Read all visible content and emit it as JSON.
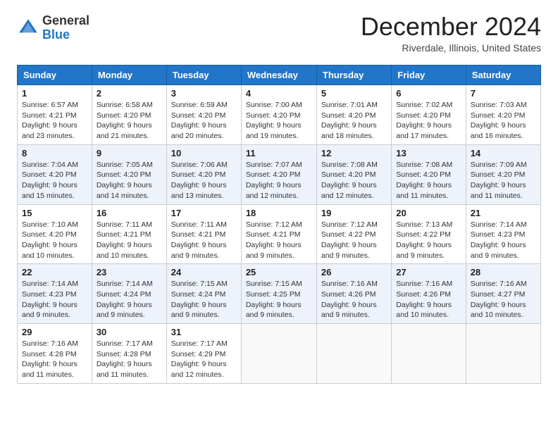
{
  "header": {
    "logo_general": "General",
    "logo_blue": "Blue",
    "month_title": "December 2024",
    "location": "Riverdale, Illinois, United States"
  },
  "days_of_week": [
    "Sunday",
    "Monday",
    "Tuesday",
    "Wednesday",
    "Thursday",
    "Friday",
    "Saturday"
  ],
  "weeks": [
    [
      {
        "day": "1",
        "sunrise": "6:57 AM",
        "sunset": "4:21 PM",
        "daylight": "9 hours and 23 minutes."
      },
      {
        "day": "2",
        "sunrise": "6:58 AM",
        "sunset": "4:20 PM",
        "daylight": "9 hours and 21 minutes."
      },
      {
        "day": "3",
        "sunrise": "6:59 AM",
        "sunset": "4:20 PM",
        "daylight": "9 hours and 20 minutes."
      },
      {
        "day": "4",
        "sunrise": "7:00 AM",
        "sunset": "4:20 PM",
        "daylight": "9 hours and 19 minutes."
      },
      {
        "day": "5",
        "sunrise": "7:01 AM",
        "sunset": "4:20 PM",
        "daylight": "9 hours and 18 minutes."
      },
      {
        "day": "6",
        "sunrise": "7:02 AM",
        "sunset": "4:20 PM",
        "daylight": "9 hours and 17 minutes."
      },
      {
        "day": "7",
        "sunrise": "7:03 AM",
        "sunset": "4:20 PM",
        "daylight": "9 hours and 16 minutes."
      }
    ],
    [
      {
        "day": "8",
        "sunrise": "7:04 AM",
        "sunset": "4:20 PM",
        "daylight": "9 hours and 15 minutes."
      },
      {
        "day": "9",
        "sunrise": "7:05 AM",
        "sunset": "4:20 PM",
        "daylight": "9 hours and 14 minutes."
      },
      {
        "day": "10",
        "sunrise": "7:06 AM",
        "sunset": "4:20 PM",
        "daylight": "9 hours and 13 minutes."
      },
      {
        "day": "11",
        "sunrise": "7:07 AM",
        "sunset": "4:20 PM",
        "daylight": "9 hours and 12 minutes."
      },
      {
        "day": "12",
        "sunrise": "7:08 AM",
        "sunset": "4:20 PM",
        "daylight": "9 hours and 12 minutes."
      },
      {
        "day": "13",
        "sunrise": "7:08 AM",
        "sunset": "4:20 PM",
        "daylight": "9 hours and 11 minutes."
      },
      {
        "day": "14",
        "sunrise": "7:09 AM",
        "sunset": "4:20 PM",
        "daylight": "9 hours and 11 minutes."
      }
    ],
    [
      {
        "day": "15",
        "sunrise": "7:10 AM",
        "sunset": "4:20 PM",
        "daylight": "9 hours and 10 minutes."
      },
      {
        "day": "16",
        "sunrise": "7:11 AM",
        "sunset": "4:21 PM",
        "daylight": "9 hours and 10 minutes."
      },
      {
        "day": "17",
        "sunrise": "7:11 AM",
        "sunset": "4:21 PM",
        "daylight": "9 hours and 9 minutes."
      },
      {
        "day": "18",
        "sunrise": "7:12 AM",
        "sunset": "4:21 PM",
        "daylight": "9 hours and 9 minutes."
      },
      {
        "day": "19",
        "sunrise": "7:12 AM",
        "sunset": "4:22 PM",
        "daylight": "9 hours and 9 minutes."
      },
      {
        "day": "20",
        "sunrise": "7:13 AM",
        "sunset": "4:22 PM",
        "daylight": "9 hours and 9 minutes."
      },
      {
        "day": "21",
        "sunrise": "7:14 AM",
        "sunset": "4:23 PM",
        "daylight": "9 hours and 9 minutes."
      }
    ],
    [
      {
        "day": "22",
        "sunrise": "7:14 AM",
        "sunset": "4:23 PM",
        "daylight": "9 hours and 9 minutes."
      },
      {
        "day": "23",
        "sunrise": "7:14 AM",
        "sunset": "4:24 PM",
        "daylight": "9 hours and 9 minutes."
      },
      {
        "day": "24",
        "sunrise": "7:15 AM",
        "sunset": "4:24 PM",
        "daylight": "9 hours and 9 minutes."
      },
      {
        "day": "25",
        "sunrise": "7:15 AM",
        "sunset": "4:25 PM",
        "daylight": "9 hours and 9 minutes."
      },
      {
        "day": "26",
        "sunrise": "7:16 AM",
        "sunset": "4:26 PM",
        "daylight": "9 hours and 9 minutes."
      },
      {
        "day": "27",
        "sunrise": "7:16 AM",
        "sunset": "4:26 PM",
        "daylight": "9 hours and 10 minutes."
      },
      {
        "day": "28",
        "sunrise": "7:16 AM",
        "sunset": "4:27 PM",
        "daylight": "9 hours and 10 minutes."
      }
    ],
    [
      {
        "day": "29",
        "sunrise": "7:16 AM",
        "sunset": "4:28 PM",
        "daylight": "9 hours and 11 minutes."
      },
      {
        "day": "30",
        "sunrise": "7:17 AM",
        "sunset": "4:28 PM",
        "daylight": "9 hours and 11 minutes."
      },
      {
        "day": "31",
        "sunrise": "7:17 AM",
        "sunset": "4:29 PM",
        "daylight": "9 hours and 12 minutes."
      },
      null,
      null,
      null,
      null
    ]
  ],
  "labels": {
    "sunrise": "Sunrise:",
    "sunset": "Sunset:",
    "daylight": "Daylight:"
  }
}
